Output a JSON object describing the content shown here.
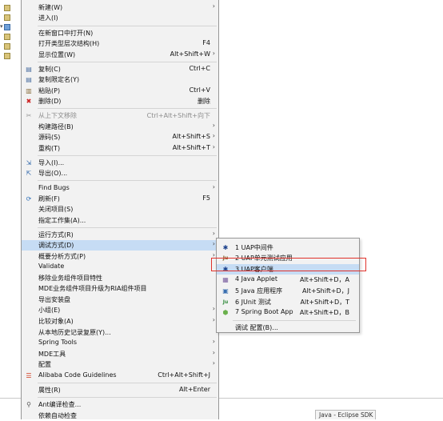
{
  "menu": {
    "items": [
      {
        "label": "新建(W)",
        "accel": "",
        "arrow": true,
        "icon": "",
        "disabled": false
      },
      {
        "label": "进入(I)",
        "accel": "",
        "arrow": false,
        "icon": "",
        "disabled": false
      },
      {
        "label": "在新窗口中打开(N)",
        "accel": "",
        "arrow": false,
        "icon": "",
        "disabled": false
      },
      {
        "label": "打开类型层次结构(H)",
        "accel": "F4",
        "arrow": false,
        "icon": "",
        "disabled": false
      },
      {
        "label": "显示位置(W)",
        "accel": "Alt+Shift+W",
        "arrow": true,
        "icon": "",
        "disabled": false
      },
      {
        "label": "复制(C)",
        "accel": "Ctrl+C",
        "arrow": false,
        "icon": "copy-icon",
        "disabled": false
      },
      {
        "label": "复制限定名(Y)",
        "accel": "",
        "arrow": false,
        "icon": "copy-qualified-icon",
        "disabled": false
      },
      {
        "label": "粘贴(P)",
        "accel": "Ctrl+V",
        "arrow": false,
        "icon": "paste-icon",
        "disabled": false
      },
      {
        "label": "删除(D)",
        "accel": "删除",
        "arrow": false,
        "icon": "delete-icon",
        "disabled": false
      },
      {
        "label": "从上下文移除",
        "accel": "Ctrl+Alt+Shift+向下",
        "arrow": false,
        "icon": "remove-context-icon",
        "disabled": true
      },
      {
        "label": "构建路径(B)",
        "accel": "",
        "arrow": true,
        "icon": "",
        "disabled": false
      },
      {
        "label": "源码(S)",
        "accel": "Alt+Shift+S",
        "arrow": true,
        "icon": "",
        "disabled": false
      },
      {
        "label": "重构(T)",
        "accel": "Alt+Shift+T",
        "arrow": true,
        "icon": "",
        "disabled": false
      },
      {
        "label": "导入(I)...",
        "accel": "",
        "arrow": false,
        "icon": "import-icon",
        "disabled": false
      },
      {
        "label": "导出(O)...",
        "accel": "",
        "arrow": false,
        "icon": "export-icon",
        "disabled": false
      },
      {
        "label": "Find Bugs",
        "accel": "",
        "arrow": true,
        "icon": "",
        "disabled": false
      },
      {
        "label": "刷新(F)",
        "accel": "F5",
        "arrow": false,
        "icon": "refresh-icon",
        "disabled": false
      },
      {
        "label": "关闭项目(S)",
        "accel": "",
        "arrow": false,
        "icon": "",
        "disabled": false
      },
      {
        "label": "指定工作集(A)...",
        "accel": "",
        "arrow": false,
        "icon": "",
        "disabled": false
      },
      {
        "label": "运行方式(R)",
        "accel": "",
        "arrow": true,
        "icon": "",
        "disabled": false
      },
      {
        "label": "调试方式(D)",
        "accel": "",
        "arrow": true,
        "icon": "",
        "disabled": false
      },
      {
        "label": "概要分析方式(P)",
        "accel": "",
        "arrow": true,
        "icon": "",
        "disabled": false
      },
      {
        "label": "Validate",
        "accel": "",
        "arrow": false,
        "icon": "",
        "disabled": false
      },
      {
        "label": "移除业务组件项目特性",
        "accel": "",
        "arrow": false,
        "icon": "",
        "disabled": false
      },
      {
        "label": "MDE业务组件项目升级为RIA组件项目",
        "accel": "",
        "arrow": false,
        "icon": "",
        "disabled": false
      },
      {
        "label": "导出安装盘",
        "accel": "",
        "arrow": false,
        "icon": "",
        "disabled": false
      },
      {
        "label": "小组(E)",
        "accel": "",
        "arrow": true,
        "icon": "",
        "disabled": false
      },
      {
        "label": "比较对象(A)",
        "accel": "",
        "arrow": true,
        "icon": "",
        "disabled": false
      },
      {
        "label": "从本地历史记录复原(Y)...",
        "accel": "",
        "arrow": false,
        "icon": "",
        "disabled": false
      },
      {
        "label": "Spring Tools",
        "accel": "",
        "arrow": true,
        "icon": "",
        "disabled": false
      },
      {
        "label": "MDE工具",
        "accel": "",
        "arrow": true,
        "icon": "",
        "disabled": false
      },
      {
        "label": "配置",
        "accel": "",
        "arrow": true,
        "icon": "",
        "disabled": false
      },
      {
        "label": "Alibaba Code Guidelines",
        "accel": "Ctrl+Alt+Shift+J",
        "arrow": false,
        "icon": "alibaba-icon",
        "disabled": false
      },
      {
        "label": "属性(R)",
        "accel": "Alt+Enter",
        "arrow": false,
        "icon": "",
        "disabled": false
      },
      {
        "label": "Ant编译检查...",
        "accel": "",
        "arrow": false,
        "icon": "ant-search-icon",
        "disabled": false
      },
      {
        "label": "依赖自动检查",
        "accel": "",
        "arrow": false,
        "icon": "",
        "disabled": false
      }
    ]
  },
  "submenu": {
    "items": [
      {
        "label": "1 UAP中间件",
        "accel": "",
        "icon": "uap-run-icon"
      },
      {
        "label": "2 UAP单元测试应用",
        "accel": "",
        "icon": "junit-uap-icon"
      },
      {
        "label": "3 UAP客户端",
        "accel": "",
        "icon": "uap-run-icon"
      },
      {
        "label": "4 Java Applet",
        "accel": "Alt+Shift+D，A",
        "icon": "applet-icon"
      },
      {
        "label": "5 Java 应用程序",
        "accel": "Alt+Shift+D，J",
        "icon": "java-app-icon"
      },
      {
        "label": "6 JUnit 测试",
        "accel": "Alt+Shift+D，T",
        "icon": "junit-icon"
      },
      {
        "label": "7 Spring Boot App",
        "accel": "Alt+Shift+D，B",
        "icon": "spring-boot-icon"
      },
      {
        "label": "调试 配置(B)...",
        "accel": "",
        "icon": ""
      }
    ]
  },
  "status": {
    "tab_label": "Java - Eclipse SDK"
  },
  "colors": {
    "highlight": "#c6dcf4",
    "callout": "#e0322b"
  }
}
